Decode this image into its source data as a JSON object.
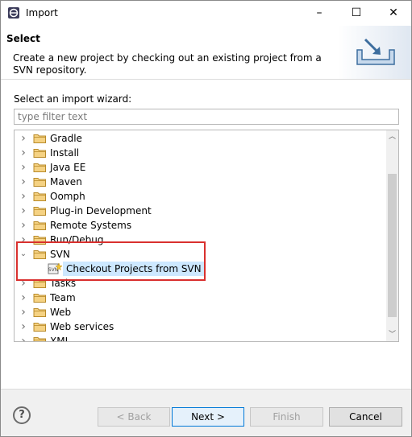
{
  "window": {
    "title": "Import",
    "controls": {
      "minimize": "–",
      "maximize": "☐",
      "close": "✕"
    }
  },
  "header": {
    "title": "Select",
    "description": "Create a new project by checking out an existing project from a SVN repository."
  },
  "wizard": {
    "prompt": "Select an import wizard:",
    "filter_placeholder": "type filter text",
    "tree": [
      {
        "label": "Gradle",
        "expanded": false
      },
      {
        "label": "Install",
        "expanded": false
      },
      {
        "label": "Java EE",
        "expanded": false
      },
      {
        "label": "Maven",
        "expanded": false
      },
      {
        "label": "Oomph",
        "expanded": false
      },
      {
        "label": "Plug-in Development",
        "expanded": false
      },
      {
        "label": "Remote Systems",
        "expanded": false
      },
      {
        "label": "Run/Debug",
        "expanded": false
      },
      {
        "label": "SVN",
        "expanded": true
      },
      {
        "label": "Checkout Projects from SVN",
        "child": true,
        "selected": true
      },
      {
        "label": "Tasks",
        "expanded": false
      },
      {
        "label": "Team",
        "expanded": false
      },
      {
        "label": "Web",
        "expanded": false
      },
      {
        "label": "Web services",
        "expanded": false
      },
      {
        "label": "XML",
        "expanded": false
      }
    ]
  },
  "footer": {
    "help": "?",
    "back": "< Back",
    "next": "Next >",
    "finish": "Finish",
    "cancel": "Cancel"
  },
  "colors": {
    "selection": "#cde8ff",
    "highlight_box": "#d9302e",
    "folder": "#e8b84a"
  }
}
